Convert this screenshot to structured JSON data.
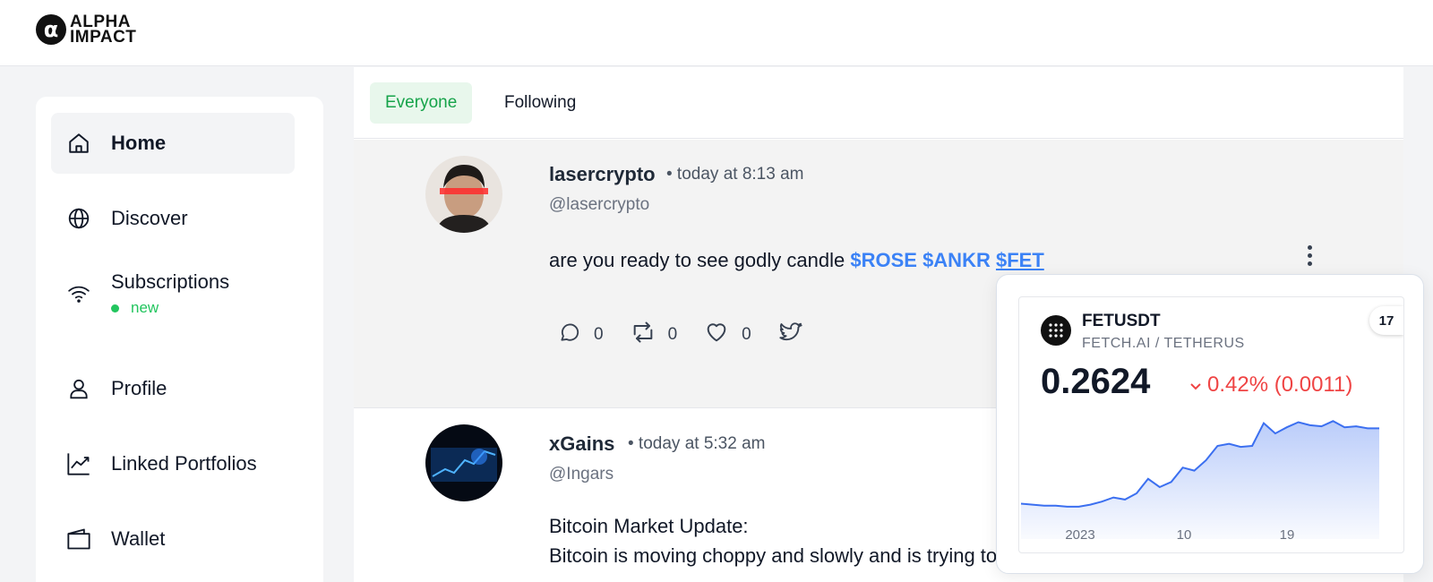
{
  "brand": {
    "line1": "ALPHA",
    "line2": "IMPACT",
    "mark": "α"
  },
  "sidebar": {
    "items": [
      {
        "label": "Home",
        "icon": "home-icon"
      },
      {
        "label": "Discover",
        "icon": "globe-icon"
      },
      {
        "label": "Subscriptions",
        "icon": "wifi-icon",
        "badge": "new"
      },
      {
        "label": "Profile",
        "icon": "user-icon"
      },
      {
        "label": "Linked Portfolios",
        "icon": "chart-trend-icon"
      },
      {
        "label": "Wallet",
        "icon": "wallet-icon"
      }
    ]
  },
  "feed": {
    "tabs": [
      {
        "label": "Everyone",
        "active": true
      },
      {
        "label": "Following",
        "active": false
      }
    ],
    "posts": [
      {
        "name": "lasercrypto",
        "time": "• today at 8:13 am",
        "handle": "@lasercrypto",
        "text": "are you ready to see godly candle",
        "tickers": [
          "$ROSE",
          "$ANKR",
          "$FET"
        ],
        "counts": {
          "comments": "0",
          "reposts": "0",
          "likes": "0"
        }
      },
      {
        "name": "xGains",
        "time": "• today at 5:32 am",
        "handle": "@Ingars",
        "text_lines": [
          "Bitcoin Market Update:",
          "Bitcoin is moving choppy and slowly and is trying to"
        ]
      }
    ]
  },
  "ticker_popup": {
    "symbol": "FETUSDT",
    "pair": "FETCH.AI / TETHERUS",
    "price": "0.2624",
    "change": "0.42% (0.0011)",
    "badge": "17",
    "colors": {
      "down": "#ef4444",
      "line": "#3b6ff0"
    }
  },
  "chart_data": {
    "type": "area",
    "x_ticks": [
      "2023",
      "10",
      "19"
    ],
    "values": [
      0.17,
      0.169,
      0.168,
      0.168,
      0.167,
      0.167,
      0.169,
      0.172,
      0.176,
      0.174,
      0.18,
      0.194,
      0.186,
      0.191,
      0.205,
      0.202,
      0.212,
      0.226,
      0.228,
      0.225,
      0.226,
      0.248,
      0.238,
      0.244,
      0.249,
      0.246,
      0.245,
      0.25,
      0.244,
      0.245,
      0.243,
      0.243
    ]
  }
}
